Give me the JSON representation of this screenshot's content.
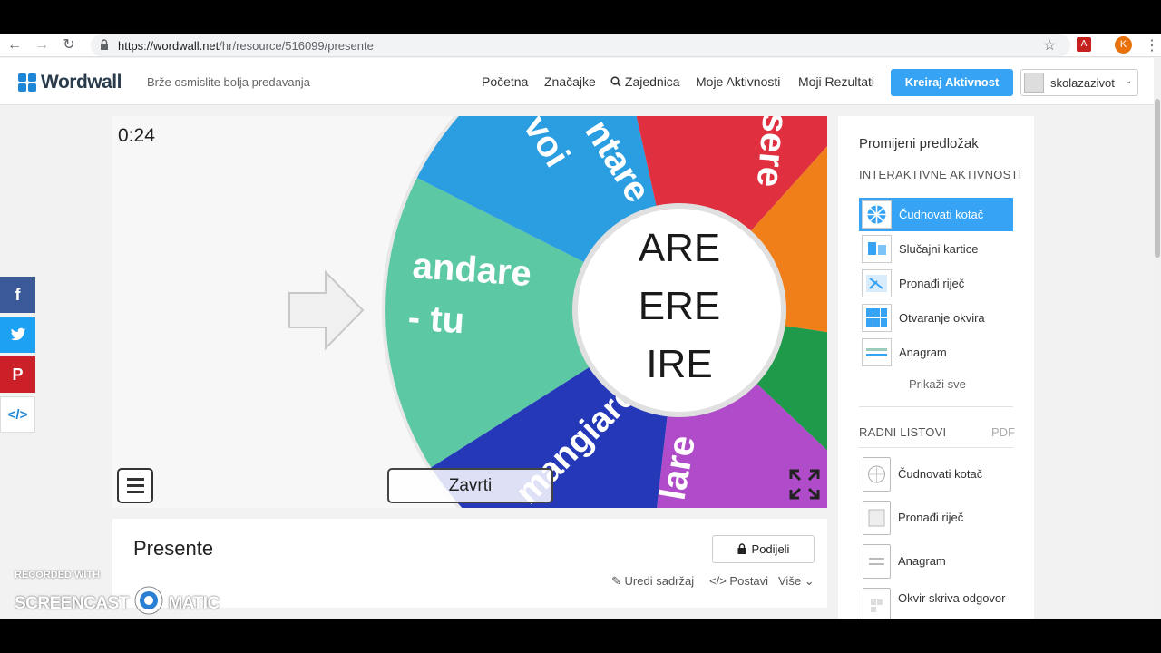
{
  "browser": {
    "url_domain": "https://wordwall.net",
    "url_path": "/hr/resource/516099/presente",
    "profile_initial": "K",
    "pdf_ext_label": "A"
  },
  "header": {
    "logo_text": "Wordwall",
    "tagline": "Brže osmislite bolja predavanja",
    "nav": [
      "Početna",
      "Značajke",
      "Zajednica",
      "Moje Aktivnosti",
      "Moji Rezultati"
    ],
    "cta_label": "Kreiraj Aktivnost",
    "username": "skolazazivot"
  },
  "game": {
    "timer": "0:24",
    "spin_label": "Zavrti",
    "hub_lines": [
      "ARE",
      "ERE",
      "IRE"
    ],
    "segments": [
      {
        "label": "andare - tu",
        "color": "#5cc9a4"
      },
      {
        "label": "cantare voi",
        "color": "#2a9ee0"
      },
      {
        "label": "essere",
        "color": "#e03040"
      },
      {
        "label": "mangiare noi",
        "color": "#2438b8"
      },
      {
        "label": "lare",
        "color": "#b04bc9"
      }
    ],
    "pointer_icon": "arrow-right-icon"
  },
  "info": {
    "title": "Presente",
    "share_label": "Podijeli",
    "actions": [
      "Uredi sadržaj",
      "Postavi",
      "Više"
    ]
  },
  "sidebar": {
    "title": "Promijeni predložak",
    "interactive_heading": "INTERAKTIVNE AKTIVNOSTI",
    "templates": [
      "Čudnovati kotač",
      "Slučajni kartice",
      "Pronađi riječ",
      "Otvaranje okvira",
      "Anagram"
    ],
    "show_all": "Prikaži sve",
    "worksheets_heading": "RADNI LISTOVI",
    "pdf_label": "PDF",
    "worksheets": [
      "Čudnovati kotač",
      "Pronađi riječ",
      "Anagram",
      "Okvir skriva odgovor"
    ]
  },
  "social": {
    "facebook": "f",
    "pinterest": "P",
    "embed": "</>"
  },
  "watermark": {
    "line1": "RECORDED WITH",
    "line2": "SCREENCAST",
    "line3": "MATIC"
  },
  "colors": {
    "accent": "#36a3f5",
    "facebook": "#3b5998",
    "twitter": "#1da1f2",
    "pinterest": "#cb2027"
  }
}
